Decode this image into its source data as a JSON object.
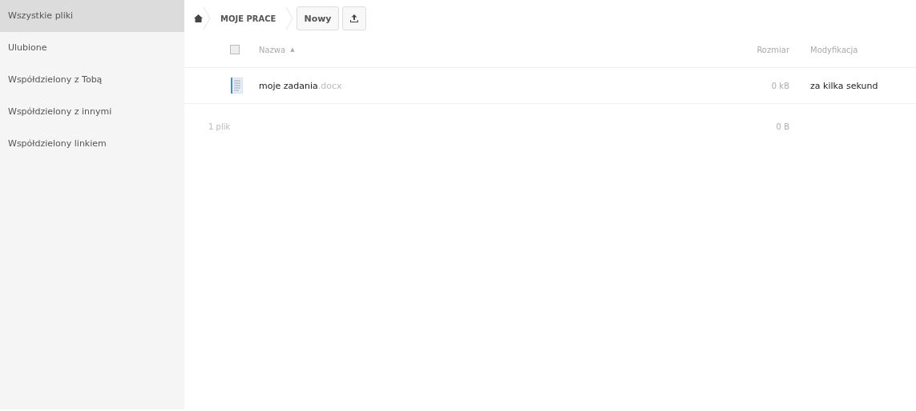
{
  "sidebar": {
    "items": [
      {
        "label": "Wszystkie pliki",
        "selected": true
      },
      {
        "label": "Ulubione",
        "selected": false
      },
      {
        "label": "Współdzielony z Tobą",
        "selected": false
      },
      {
        "label": "Współdzielony z innymi",
        "selected": false
      },
      {
        "label": "Współdzielony linkiem",
        "selected": false
      }
    ]
  },
  "breadcrumb": {
    "folder": "MOJE PRACE"
  },
  "toolbar": {
    "new_button": "Nowy"
  },
  "table": {
    "columns": {
      "name": "Nazwa",
      "sort_indicator": "▲",
      "size": "Rozmiar",
      "modified": "Modyfikacja"
    },
    "select_all_checked": false,
    "rows": [
      {
        "name": "moje zadania",
        "extension": ".docx",
        "size": "0 kB",
        "modified": "za kilka sekund"
      }
    ],
    "summary": {
      "count": "1 plik",
      "size": "0 B"
    }
  }
}
